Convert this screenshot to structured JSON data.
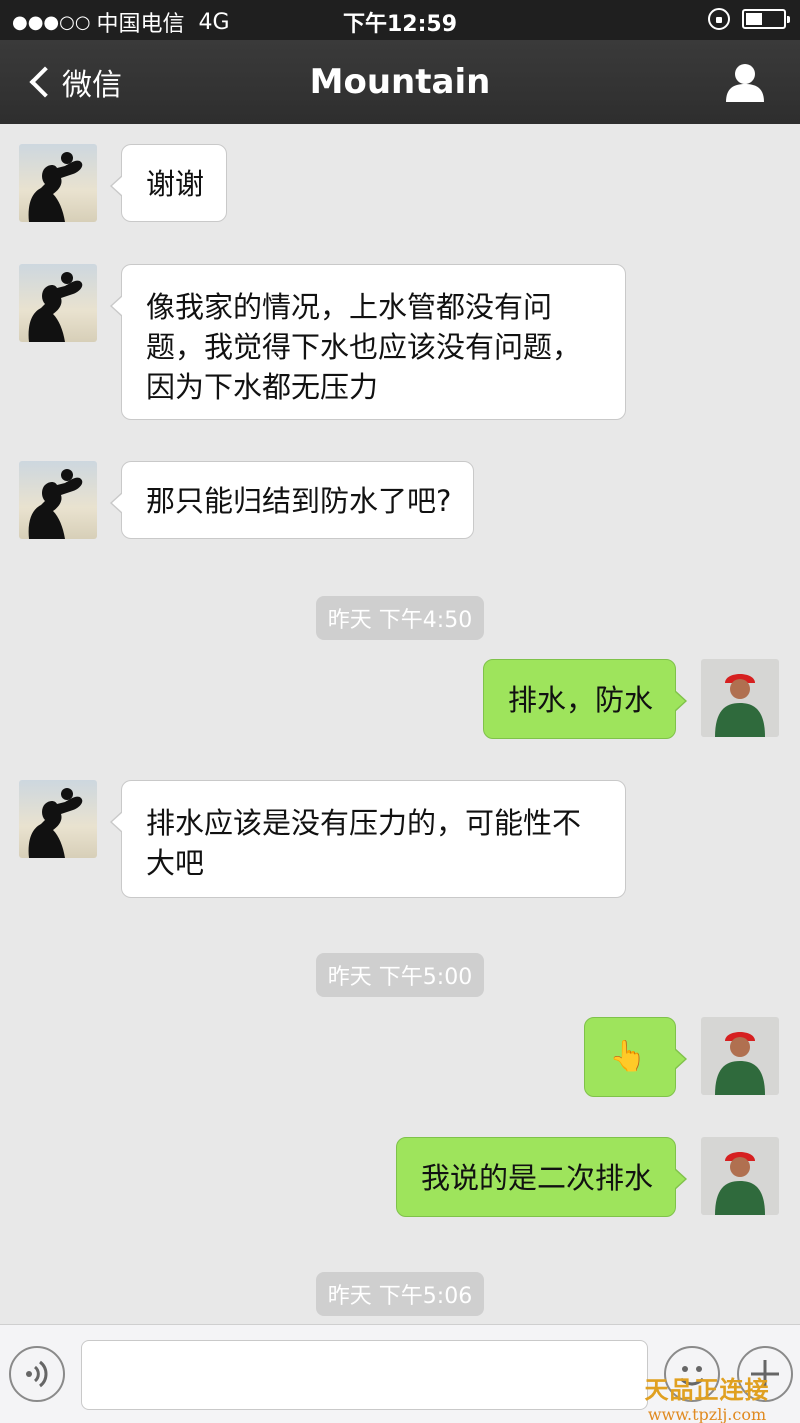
{
  "status_bar": {
    "signal": "●●●○○",
    "carrier": "中国电信",
    "network": "4G",
    "time": "下午12:59",
    "battery_level": 0.45
  },
  "nav": {
    "back_label": "微信",
    "title": "Mountain"
  },
  "messages": [
    {
      "side": "left",
      "text": "谢谢"
    },
    {
      "side": "left",
      "text": "像我家的情况，上水管都没有问题，我觉得下水也应该没有问题，因为下水都无压力"
    },
    {
      "side": "left",
      "text": "那只能归结到防水了吧?"
    },
    {
      "type": "time",
      "text": "昨天 下午4:50"
    },
    {
      "side": "right",
      "text": "排水，防水"
    },
    {
      "side": "left",
      "text": "排水应该是没有压力的，可能性不大吧"
    },
    {
      "type": "time",
      "text": "昨天 下午5:00"
    },
    {
      "side": "right",
      "emoji": "👆"
    },
    {
      "side": "right",
      "text": "我说的是二次排水"
    },
    {
      "type": "time",
      "text": "昨天 下午5:06"
    }
  ],
  "watermark": {
    "line1": "天品正连接",
    "line2": "www.tpzlj.com"
  },
  "colors": {
    "sent_bubble": "#9ee45c",
    "received_bubble": "#ffffff",
    "nav_bg": "#333333"
  }
}
